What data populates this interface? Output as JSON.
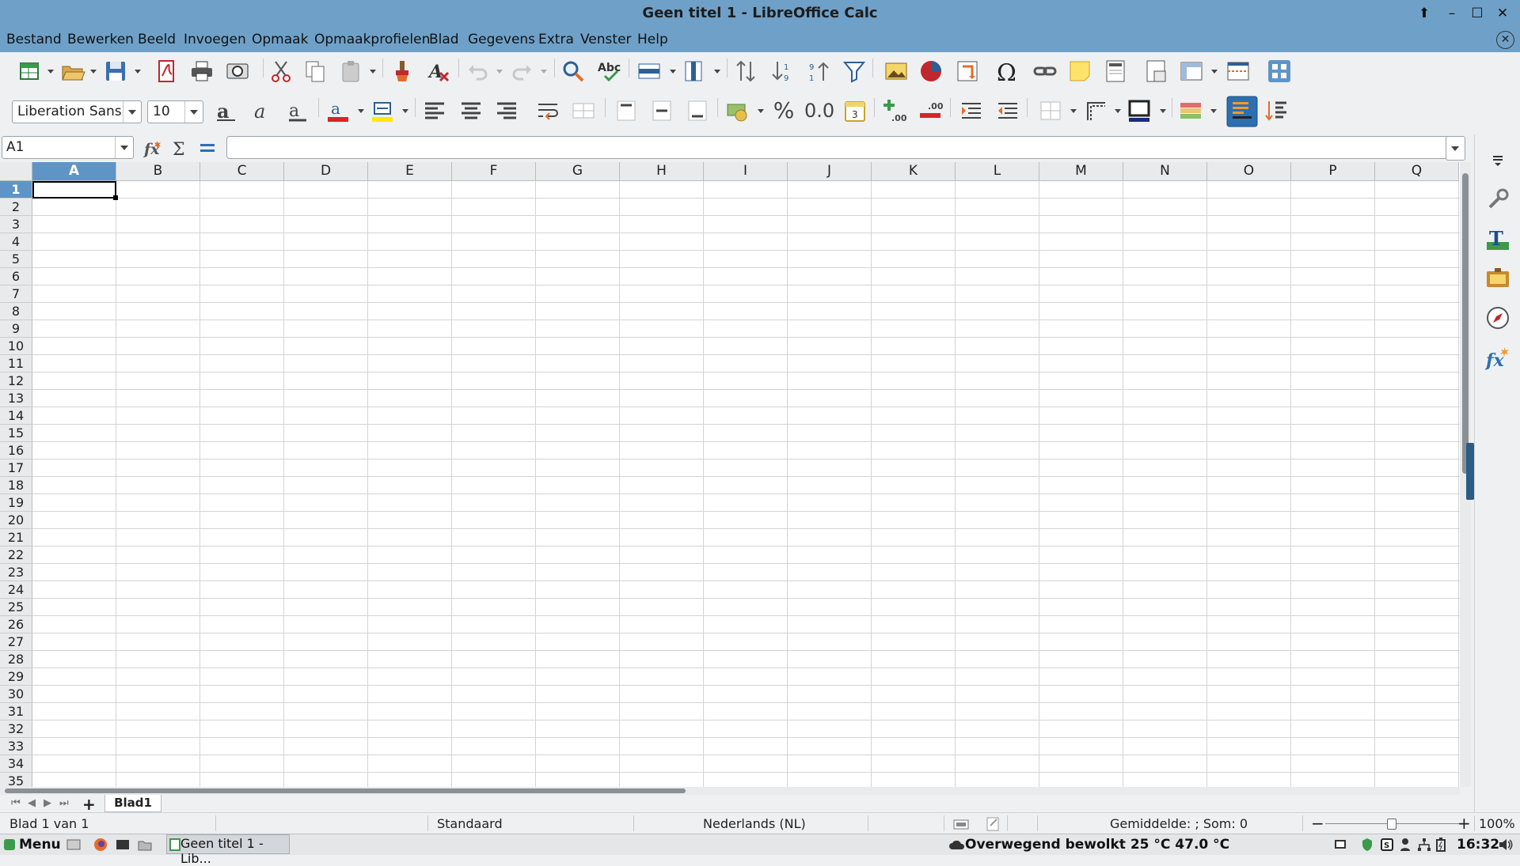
{
  "window": {
    "title": "Geen titel 1 - LibreOffice Calc"
  },
  "menu": [
    "Bestand",
    "Bewerken",
    "Beeld",
    "Invoegen",
    "Opmaak",
    "Opmaakprofielen",
    "Blad",
    "Gegevens",
    "Extra",
    "Venster",
    "Help"
  ],
  "toolbar": {
    "font_name": "Liberation Sans",
    "font_size": "10",
    "percent_label": "%",
    "decimal_label": "0.0",
    "icons_std": [
      "new-icon",
      "open-icon",
      "save-icon",
      "export-pdf-icon",
      "print-icon",
      "print-preview-icon",
      "cut-icon",
      "copy-icon",
      "paste-icon",
      "clone-formatting-icon",
      "clear-formatting-icon",
      "undo-icon",
      "redo-icon",
      "find-replace-icon",
      "spellcheck-icon",
      "row-icon",
      "column-icon",
      "sort-icon",
      "sort-ascending-icon",
      "sort-descending-icon",
      "autofilter-icon",
      "insert-image-icon",
      "insert-chart-icon",
      "pivot-table-icon",
      "special-character-icon",
      "hyperlink-icon",
      "comment-icon",
      "header-footer-icon",
      "define-print-area-icon",
      "freeze-rows-columns-icon",
      "split-window-icon",
      "show-draw-functions-icon"
    ],
    "icons_fmt": [
      "bold-icon",
      "italic-icon",
      "underline-icon",
      "font-color-icon",
      "highlight-color-icon",
      "align-left-icon",
      "align-center-icon",
      "align-right-icon",
      "wrap-text-icon",
      "merge-center-icon",
      "align-top-icon",
      "center-vertically-icon",
      "align-bottom-icon",
      "currency-icon",
      "percent-icon",
      "number-icon",
      "date-icon",
      "add-decimal-icon",
      "delete-decimal-icon",
      "increase-indent-icon",
      "decrease-indent-icon",
      "borders-icon",
      "border-style-icon",
      "border-color-icon",
      "conditional-icon",
      "text-orientation-icon",
      "text-direction-icon"
    ]
  },
  "formula": {
    "name_box": "A1",
    "fx_icon": "function-wizard-icon",
    "sum_icon": "sum-icon",
    "eq_icon": "formula-icon",
    "content": ""
  },
  "columns": [
    "A",
    "B",
    "C",
    "D",
    "E",
    "F",
    "G",
    "H",
    "I",
    "J",
    "K",
    "L",
    "M",
    "N",
    "O",
    "P",
    "Q"
  ],
  "rows": [
    "1",
    "2",
    "3",
    "4",
    "5",
    "6",
    "7",
    "8",
    "9",
    "10",
    "11",
    "12",
    "13",
    "14",
    "15",
    "16",
    "17",
    "18",
    "19",
    "20",
    "21",
    "22",
    "23",
    "24",
    "25",
    "26",
    "27",
    "28",
    "29",
    "30",
    "31",
    "32",
    "33",
    "34",
    "35"
  ],
  "selected_cell": {
    "column": "A",
    "row": "1"
  },
  "sheet_tabs": [
    "Blad1"
  ],
  "status": {
    "sheet": "Blad 1 van 1",
    "style": "Standaard",
    "language": "Nederlands (NL)",
    "summary": "Gemiddelde: ; Som: 0",
    "zoom": "100%",
    "zoom_level": 1.0
  },
  "sidebar_icons": [
    "sidebar-menu-icon",
    "properties-icon",
    "styles-icon",
    "gallery-icon",
    "navigator-icon",
    "functions-icon"
  ],
  "taskbar": {
    "menu": "Menu",
    "window": "Geen titel 1 - Lib...",
    "weather": "Overwegend bewolkt 25 °C 47.0 °C",
    "clock": "16:32"
  },
  "colors": {
    "titlebar": "#6fa1c8",
    "selection": "#5f95c6",
    "grid": "#d4d4d4"
  }
}
